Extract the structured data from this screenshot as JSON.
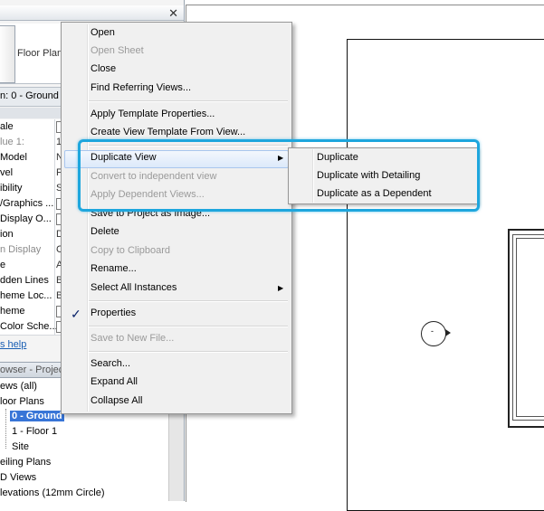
{
  "properties": {
    "type_label": "Floor Plan",
    "view_selector": "n: 0 - Ground",
    "close_glyph": "✕",
    "rows": [
      {
        "key": "ale",
        "value": "",
        "dim": false,
        "checkbox": false
      },
      {
        "key": "lue   1:",
        "value": "1",
        "dim": true,
        "checkbox": false
      },
      {
        "key": "Model",
        "value": "N",
        "dim": false,
        "checkbox": false
      },
      {
        "key": "vel",
        "value": "F",
        "dim": false,
        "checkbox": false
      },
      {
        "key": "ibility",
        "value": "S",
        "dim": false,
        "checkbox": false
      },
      {
        "key": "/Graphics ...",
        "value": "",
        "dim": false,
        "checkbox": true
      },
      {
        "key": "Display O...",
        "value": "",
        "dim": false,
        "checkbox": true
      },
      {
        "key": "ion",
        "value": "D",
        "dim": false,
        "checkbox": false
      },
      {
        "key": "n Display",
        "value": "C",
        "dim": true,
        "checkbox": false
      },
      {
        "key": "e",
        "value": "A",
        "dim": false,
        "checkbox": false
      },
      {
        "key": "dden Lines",
        "value": "B",
        "dim": false,
        "checkbox": false
      },
      {
        "key": "heme Loc...",
        "value": "B",
        "dim": false,
        "checkbox": false
      },
      {
        "key": "heme",
        "value": "",
        "dim": false,
        "checkbox": true
      },
      {
        "key": "Color Sche...",
        "value": "",
        "dim": false,
        "checkbox": true
      }
    ],
    "help_link": "s help"
  },
  "browser": {
    "title": "owser - Project",
    "items": [
      {
        "label": "ews (all)",
        "selected": false
      },
      {
        "label": "loor Plans",
        "selected": false
      },
      {
        "label": "0 - Ground",
        "selected": true
      },
      {
        "label": "1 - Floor 1",
        "selected": false
      },
      {
        "label": "Site",
        "selected": false
      },
      {
        "label": "eiling Plans",
        "selected": false
      },
      {
        "label": "D Views",
        "selected": false
      },
      {
        "label": "levations (12mm Circle)",
        "selected": false
      }
    ]
  },
  "canvas": {
    "elevation_marker_label": "-"
  },
  "context_menu": {
    "items": [
      {
        "label": "Open",
        "disabled": false
      },
      {
        "label": "Open Sheet",
        "disabled": true
      },
      {
        "label": "Close",
        "disabled": false
      },
      {
        "label": "Find Referring Views...",
        "disabled": false
      },
      {
        "label": "Apply Template Properties...",
        "disabled": false
      },
      {
        "label": "Create View Template From View...",
        "disabled": false
      },
      {
        "label": "Duplicate View",
        "disabled": false,
        "submenu": true
      },
      {
        "label": "Convert to independent view",
        "disabled": true
      },
      {
        "label": "Apply Dependent Views...",
        "disabled": true
      },
      {
        "label": "Save to Project as Image...",
        "disabled": false
      },
      {
        "label": "Delete",
        "disabled": false
      },
      {
        "label": "Copy to Clipboard",
        "disabled": true
      },
      {
        "label": "Rename...",
        "disabled": false
      },
      {
        "label": "Select All Instances",
        "disabled": false,
        "submenu": true
      },
      {
        "label": "Properties",
        "disabled": false,
        "checked": true
      },
      {
        "label": "Save to New File...",
        "disabled": true
      },
      {
        "label": "Search...",
        "disabled": false
      },
      {
        "label": "Expand All",
        "disabled": false
      },
      {
        "label": "Collapse All",
        "disabled": false
      }
    ],
    "submenu_arrow": "▶",
    "check_glyph": "✓"
  },
  "submenu": {
    "items": [
      {
        "label": "Duplicate"
      },
      {
        "label": "Duplicate with Detailing"
      },
      {
        "label": "Duplicate as a Dependent"
      }
    ]
  },
  "colors": {
    "callout": "#1ea6dd",
    "selection": "#3875d7"
  }
}
